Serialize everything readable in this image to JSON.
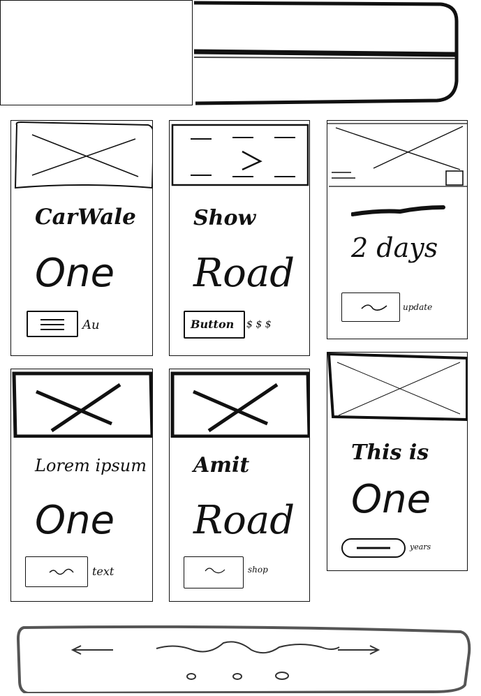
{
  "header": {},
  "cards": [
    {
      "title": "CarWale",
      "subtitle": "One",
      "button_label": "",
      "side_text": "Au"
    },
    {
      "title": "Show",
      "subtitle": "Road",
      "button_label": "Button",
      "side_text": "$ $ $"
    },
    {
      "title": "",
      "subtitle": "2 days",
      "button_label": "",
      "side_text": "update"
    },
    {
      "title": "Lorem ipsum",
      "subtitle": "One",
      "button_label": "",
      "side_text": "text"
    },
    {
      "title": "Amit",
      "subtitle": "Road",
      "button_label": "",
      "side_text": "shop"
    },
    {
      "title": "This is",
      "subtitle": "One",
      "button_label": "",
      "side_text": "years"
    }
  ],
  "nav": {
    "prev_icon": "arrow-left-icon",
    "next_icon": "arrow-right-icon",
    "dots": 3
  }
}
